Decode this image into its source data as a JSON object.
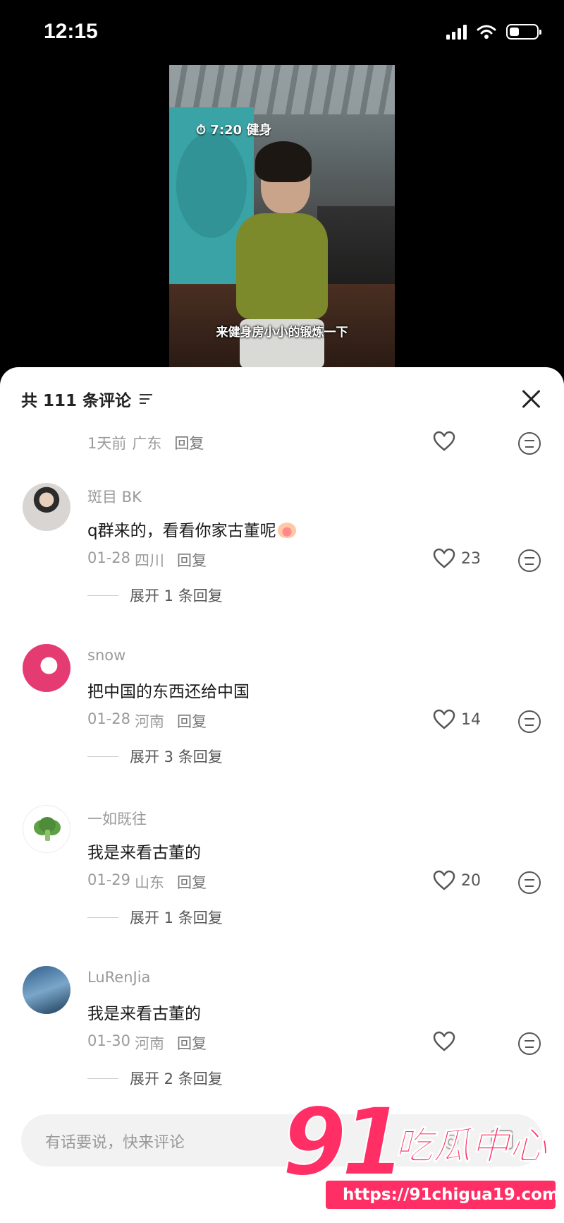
{
  "status_bar": {
    "time": "12:15"
  },
  "video": {
    "tag": "⏱ 7:20 健身",
    "caption": "来健身房小小的锻炼一下"
  },
  "comments_panel": {
    "title": "共 111 条评论",
    "top_partial": {
      "meta_time": "1天前",
      "meta_location": "广东",
      "reply_label": "回复"
    },
    "comments": [
      {
        "username": "斑目 BK",
        "text": "q群来的，看看你家古董呢",
        "date": "01-28",
        "location": "四川",
        "reply_label": "回复",
        "likes": "23",
        "expand": "展开 1 条回复"
      },
      {
        "username": "snow",
        "text": "把中国的东西还给中国",
        "date": "01-28",
        "location": "河南",
        "reply_label": "回复",
        "likes": "14",
        "expand": "展开 3 条回复"
      },
      {
        "username": "一如既往",
        "text": "我是来看古董的",
        "date": "01-29",
        "location": "山东",
        "reply_label": "回复",
        "likes": "20",
        "expand": "展开 1 条回复"
      },
      {
        "username": "LuRenJia",
        "text": "我是来看古董的",
        "date": "01-30",
        "location": "河南",
        "reply_label": "回复",
        "likes": "",
        "expand": "展开 2 条回复"
      }
    ],
    "input_placeholder": "有话要说，快来评论"
  },
  "watermark": {
    "number": "91",
    "name": "吃瓜中心",
    "url": "https://91chigua19.com"
  },
  "colors": {
    "brand_pink": "#ff2f66",
    "sheet_bg": "#ffffff",
    "muted_text": "#9a9a9a"
  }
}
